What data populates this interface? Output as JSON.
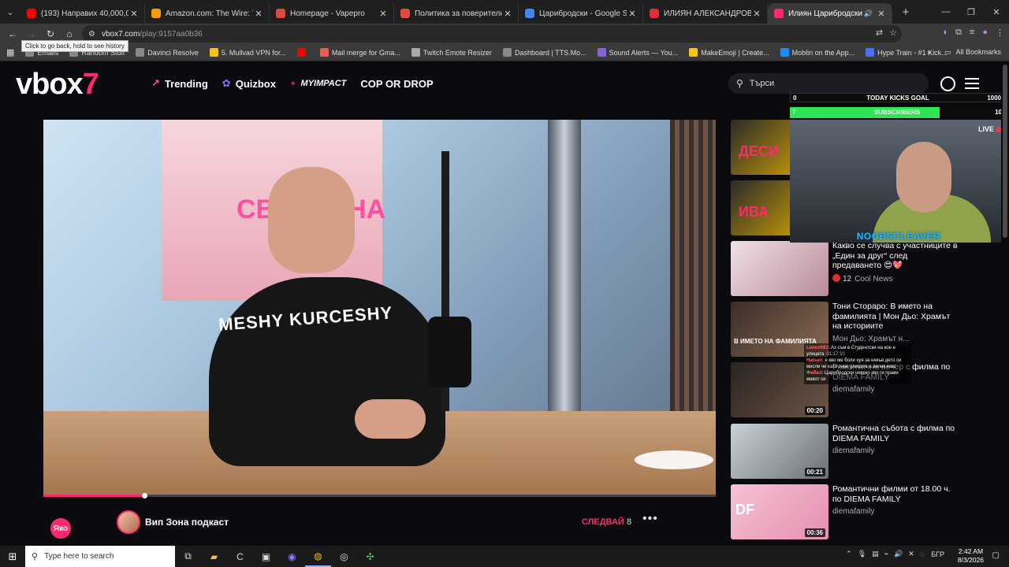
{
  "browser": {
    "tabs": [
      {
        "title": "(193) Направих 40,000,000 лева",
        "favicon_color": "#ff0000",
        "icon": "youtube-icon",
        "active": false
      },
      {
        "title": "Amazon.com: The Wire: The Co",
        "favicon_color": "#ff9900",
        "icon": "amazon-icon",
        "active": false
      },
      {
        "title": "Homepage - Vapepro",
        "favicon_color": "#e04a3f",
        "icon": "vapepro-icon",
        "active": false
      },
      {
        "title": "Политика за поверителност и",
        "favicon_color": "#e04a3f",
        "icon": "vapepro-icon",
        "active": false
      },
      {
        "title": "Царибродски - Google Search",
        "favicon_color": "#4285f4",
        "icon": "google-icon",
        "active": false
      },
      {
        "title": "ИЛИЯН АЛЕКСАНДРОВ ЦАРИ",
        "favicon_color": "#e02d3c",
        "icon": "site-icon",
        "active": false
      },
      {
        "title": "Илиян Царибродски - ли",
        "favicon_color": "#ff2a6d",
        "icon": "vbox7-icon",
        "active": true
      }
    ],
    "url_host": "vbox7.com",
    "url_path": "/play:9157aa0b36",
    "back_tooltip": "Click to go back, hold to see history",
    "bookmarks": [
      {
        "label": "Emails",
        "color": "#888"
      },
      {
        "label": "Random Stuff",
        "color": "#888"
      },
      {
        "label": "Davinci Resolve",
        "color": "#888"
      },
      {
        "label": "5. Mullvad VPN for...",
        "color": "#f5c518"
      },
      {
        "label": "",
        "color": "#ff0000"
      },
      {
        "label": "Mail merge for Gma...",
        "color": "#e8604c"
      },
      {
        "label": "Twitch Emote Resizer",
        "color": "#aaa"
      },
      {
        "label": "Dashboard | TTS.Mo...",
        "color": "#888"
      },
      {
        "label": "Sound Alerts — You...",
        "color": "#8a63d2"
      },
      {
        "label": "MakeEmoji | Create...",
        "color": "#f5c518"
      },
      {
        "label": "Moblin on the App...",
        "color": "#1a8cff"
      },
      {
        "label": "Hype Train - #1 Kick...",
        "color": "#4c6ef5"
      }
    ],
    "all_bookmarks": "All Bookmarks"
  },
  "site": {
    "logo_main": "vbox",
    "logo_accent": "7",
    "nav": [
      {
        "label": "Trending",
        "icon": "trending-icon"
      },
      {
        "label": "Quizbox",
        "icon": "quizbox-icon"
      },
      {
        "label": "MYIMPACT",
        "icon": "impact-icon"
      },
      {
        "label": "COP OR DROP",
        "icon": ""
      }
    ],
    "search_placeholder": "Търси",
    "accent": "#ff2a6d"
  },
  "player": {
    "poster_text": "СВЕТЛАНА",
    "shirt_text": "MESHY KURCESHY",
    "progress": 0.15
  },
  "below_player": {
    "mini_logo": "Яко",
    "channel_name": "Вип Зона подкаст",
    "follow_label": "СЛЕДВАЙ",
    "follow_count": "8"
  },
  "sidebar": [
    {
      "title": "",
      "source": "",
      "duration": "",
      "thumb_text": "ДЕСИ"
    },
    {
      "title": "",
      "source": "",
      "duration": "",
      "thumb_text": "ИВА"
    },
    {
      "title": "Какво се случва с участниците в „Един за друг“ след предаването 😍💖",
      "source": "Cool News",
      "count": "12",
      "duration": "",
      "thumb_text": ""
    },
    {
      "title": "Тони Стораро: В името на фамилията | Мон Дьо: Храмът на историите",
      "source": "Мон Дьо: Храмът н...",
      "duration": "",
      "thumb_text": "В ИМЕТО НА ФАМИЛИЯТА"
    },
    {
      "title": "Романтична вечер с филма по DIEMA FAMILY",
      "source": "diemafamily",
      "duration": "00:20",
      "thumb_text": ""
    },
    {
      "title": "Романтична събота с филма по DIEMA FAMILY",
      "source": "diemafamily",
      "duration": "00:21",
      "thumb_text": ""
    },
    {
      "title": "Романтични филми от 18.00 ч. по DIEMA FAMILY",
      "source": "diemafamily",
      "duration": "00:36",
      "thumb_text": "DF"
    }
  ],
  "overlay": {
    "goal_left": "0",
    "goal_label": "TODAY KICKS GOAL",
    "goal_right": "1000",
    "sub_left": "7",
    "sub_label": "SUBSCRIBERS",
    "sub_right": "10",
    "sub_progress": 0.7,
    "live_label": "LIVE",
    "handle": "NOOBSCLEAVER",
    "chat": [
      {
        "user": "Lenov593",
        "text": "Аз съм в Студентски на кое е улицата",
        "time": "01:17:10"
      },
      {
        "user": "Hatsan",
        "text": "е кво ме боли хуя за някъв дето си мисли че като знае улиците е велик кекс",
        "time": ""
      },
      {
        "user": "Фибел",
        "text": "Царибродски човеко кво ги прави живот си",
        "time": ""
      }
    ]
  },
  "taskbar": {
    "search_placeholder": "Type here to search",
    "lang": "БГР",
    "time": "2:42 AM",
    "date": "8/3/2026"
  }
}
